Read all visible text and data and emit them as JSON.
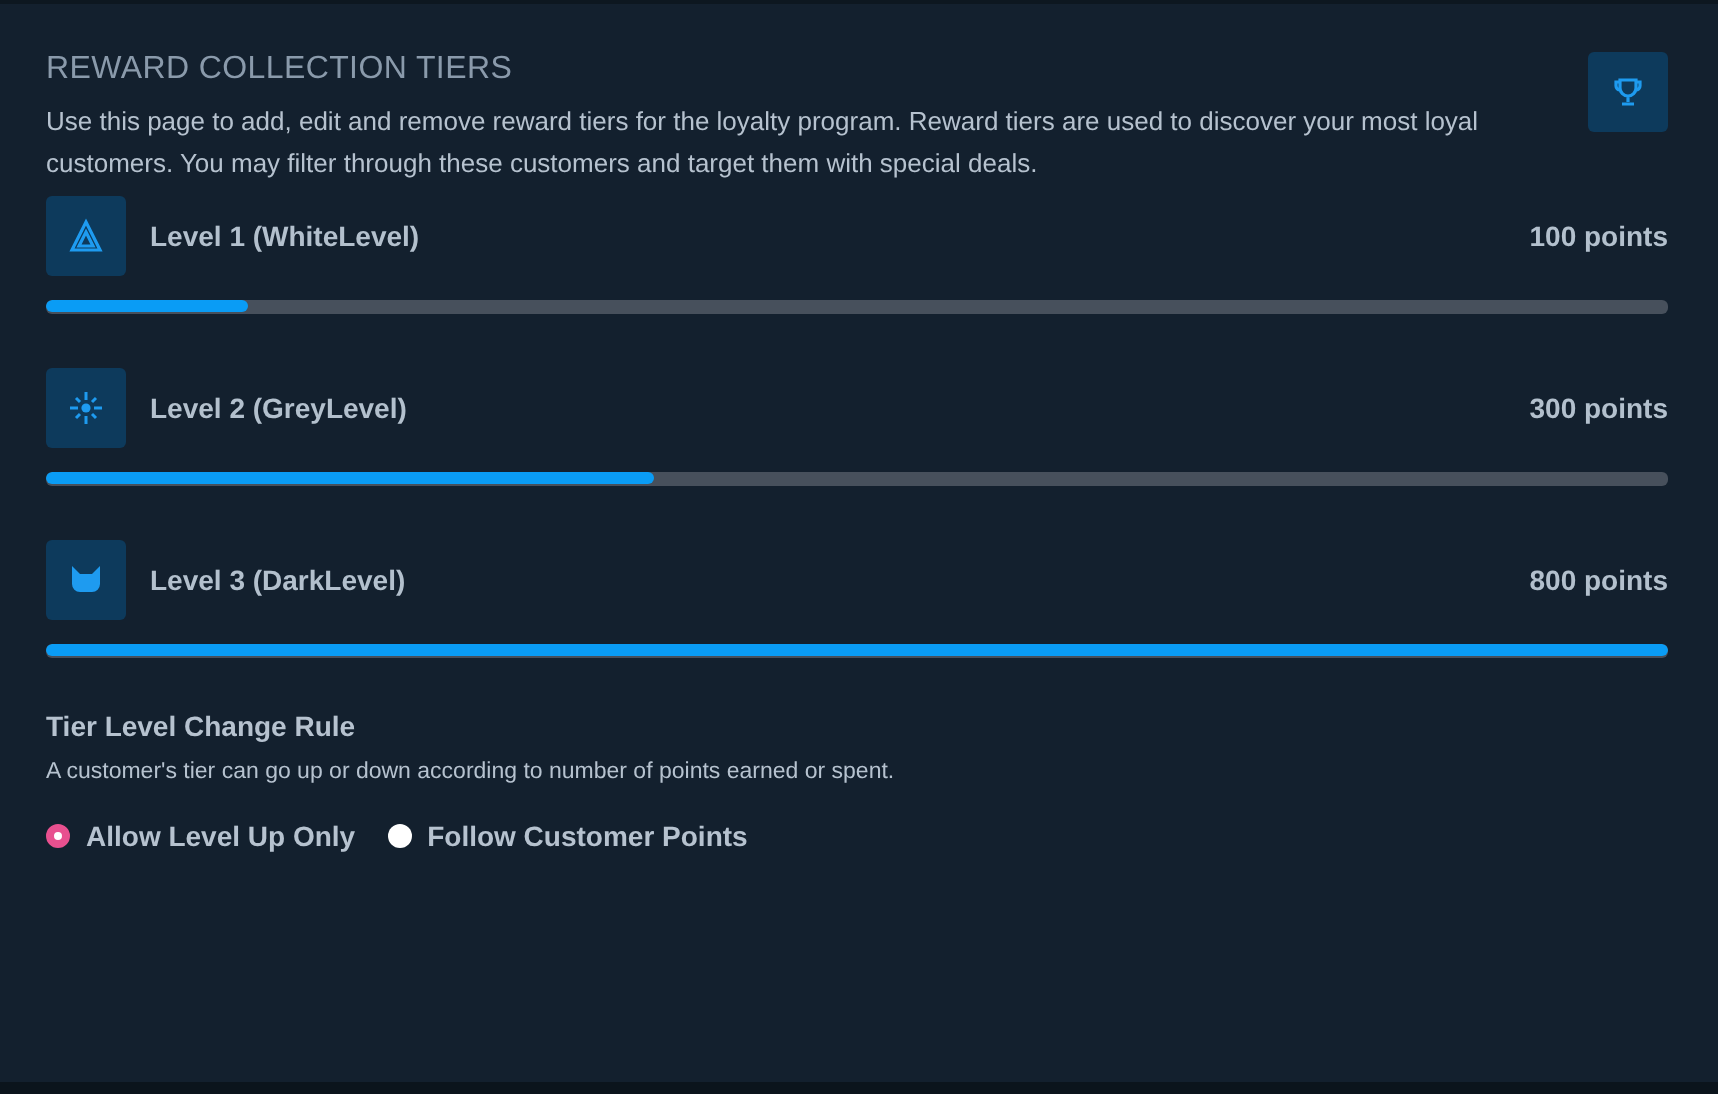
{
  "header": {
    "title": "REWARD COLLECTION TIERS",
    "description": "Use this page to add, edit and remove reward tiers for the loyalty program. Reward tiers are used to discover your most loyal customers. You may filter through these customers and target them with special deals."
  },
  "tiers": [
    {
      "name": "Level 1 (WhiteLevel)",
      "points": "100 points",
      "level": 0.125
    },
    {
      "name": "Level 2 (GreyLevel)",
      "points": "300 points",
      "level": 0.375
    },
    {
      "name": "Level 3 (DarkLevel)",
      "points": "800 points",
      "level": 1
    }
  ],
  "rule": {
    "title": "Tier Level Change Rule",
    "description": "A customer's tier can go up or down according to number of points earned or spent.",
    "options": [
      {
        "label": "Allow Level Up Only",
        "selected": true
      },
      {
        "label": "Follow Customer Points",
        "selected": false
      }
    ]
  }
}
